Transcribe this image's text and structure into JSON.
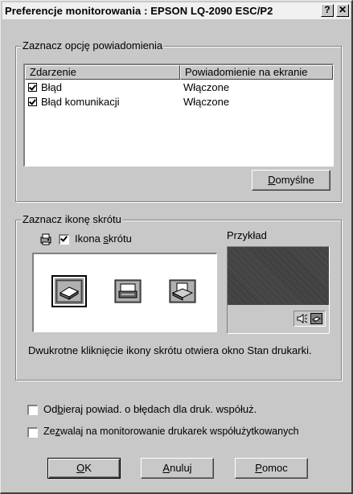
{
  "window": {
    "title": "Preferencje monitorowania : EPSON LQ-2090 ESC/P2",
    "help_glyph": "?",
    "close_glyph": "✕"
  },
  "notification_group": {
    "legend": "Zaznacz opcję powiadomienia",
    "columns": [
      "Zdarzenie",
      "Powiadomienie na ekranie"
    ],
    "rows": [
      {
        "event": "Błąd",
        "notification": "Włączone",
        "checked": true
      },
      {
        "event": "Błąd komunikacji",
        "notification": "Włączone",
        "checked": true
      }
    ],
    "defaults_button": {
      "prefix": "",
      "accel": "D",
      "rest": "omyślne"
    }
  },
  "shortcut_group": {
    "legend": "Zaznacz ikonę skrótu",
    "shortcut_checkbox": {
      "label_prefix": "Ikona ",
      "accel": "s",
      "label_rest": "krótu",
      "checked": true
    },
    "example_label": "Przykład",
    "icons": [
      "printer-icon",
      "printer-monitor-icon",
      "printer-paper-icon"
    ],
    "selected_icon": 0,
    "description": "Dwukrotne kliknięcie ikony skrótu otwiera okno Stan drukarki."
  },
  "options": [
    {
      "label_prefix": "Od",
      "accel": "b",
      "label_rest": "ieraj powiad. o błędach dla druk. współuż.",
      "checked": false
    },
    {
      "label_prefix": "Ze",
      "accel": "z",
      "label_rest": "walaj na monitorowanie drukarek współużytkowanych",
      "checked": false
    }
  ],
  "buttons": {
    "ok": {
      "accel": "O",
      "rest": "K"
    },
    "cancel": {
      "accel": "A",
      "rest": "nuluj"
    },
    "help": {
      "accel": "P",
      "rest": "omoc"
    }
  },
  "colors": {
    "dialog_face": "#c8c8c8",
    "titlebar": "#f0f0f0",
    "preview_desktop": "#4a4a4a"
  }
}
